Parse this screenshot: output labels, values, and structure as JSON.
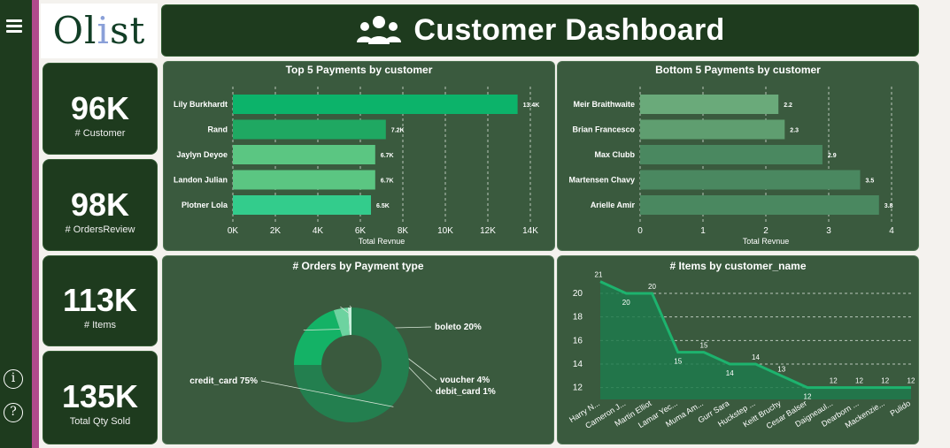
{
  "sidebar": {
    "menu_icon": "hamburger-menu-icon",
    "info_label": "i",
    "help_label": "?"
  },
  "logo": {
    "text_start": "Ol",
    "text_accent": "i",
    "text_end": "st"
  },
  "header": {
    "title": "Customer Dashboard",
    "icon": "users-group-icon"
  },
  "kpis": [
    {
      "value": "96K",
      "label": "# Customer"
    },
    {
      "value": "98K",
      "label": "# OrdersReview"
    },
    {
      "value": "113K",
      "label": "# Items"
    },
    {
      "value": "135K",
      "label": "Total Qty Sold"
    }
  ],
  "chart_data": [
    {
      "type": "bar",
      "orientation": "horizontal",
      "title": "Top 5 Payments by customer",
      "xlabel": "Total Revnue",
      "categories": [
        "Lily Burkhardt",
        "Rand",
        "Jaylyn Deyoe",
        "Landon Julian",
        "Plotner Lola"
      ],
      "values": [
        13400,
        7200,
        6700,
        6700,
        6500
      ],
      "data_labels": [
        "13.4K",
        "7.2K",
        "6.7K",
        "6.7K",
        "6.5K"
      ],
      "xlim": [
        0,
        14000
      ],
      "xticks": [
        0,
        2000,
        4000,
        6000,
        8000,
        10000,
        12000,
        14000
      ],
      "xtick_labels": [
        "0K",
        "2K",
        "4K",
        "6K",
        "8K",
        "10K",
        "12K",
        "14K"
      ],
      "colors": [
        "#0cb36a",
        "#1fa862",
        "#5bc682",
        "#5bc682",
        "#33cc8c"
      ],
      "grid": true
    },
    {
      "type": "bar",
      "orientation": "horizontal",
      "title": "Bottom 5 Payments by customer",
      "xlabel": "Total Revnue",
      "categories": [
        "Meir Braithwaite",
        "Brian Francesco",
        "Max Clubb",
        "Martensen Chavy",
        "Arielle Amir"
      ],
      "values": [
        2.2,
        2.3,
        2.9,
        3.5,
        3.8
      ],
      "data_labels": [
        "2.2",
        "2.3",
        "2.9",
        "3.5",
        "3.8"
      ],
      "xlim": [
        0,
        4
      ],
      "xticks": [
        0,
        1,
        2,
        3,
        4
      ],
      "xtick_labels": [
        "0",
        "1",
        "2",
        "3",
        "4"
      ],
      "colors": [
        "#6aaa7a",
        "#5f9e70",
        "#4a8860",
        "#4a8860",
        "#4a8860"
      ],
      "grid": true
    },
    {
      "type": "pie",
      "donut": true,
      "title": "# Orders by Payment type",
      "categories": [
        "credit_card",
        "boleto",
        "voucher",
        "debit_card"
      ],
      "values": [
        75,
        20,
        4,
        1
      ],
      "data_labels": [
        "credit_card 75%",
        "boleto 20%",
        "voucher 4%",
        "debit_card 1%"
      ],
      "colors": [
        "#237f4f",
        "#14b266",
        "#6dd3a0",
        "#c8f0dc"
      ]
    },
    {
      "type": "area",
      "title": "# Items by customer_name",
      "categories": [
        "Harry N...",
        "Cameron J...",
        "Martin Elliot",
        "Lamar Yec...",
        "Muma Am...",
        "Gurr Sara",
        "Huckstep ...",
        "Keitt Bruchy",
        "Cesar Balser",
        "Daigneaul...",
        "Dearborn ...",
        "Mackenzie...",
        "Pulido"
      ],
      "values": [
        21,
        20,
        20,
        15,
        15,
        14,
        14,
        13,
        12,
        12,
        12,
        12,
        12
      ],
      "ylim": [
        11,
        21.5
      ],
      "yticks": [
        12,
        14,
        16,
        18,
        20
      ],
      "color": "#1db36e",
      "grid": true
    }
  ]
}
